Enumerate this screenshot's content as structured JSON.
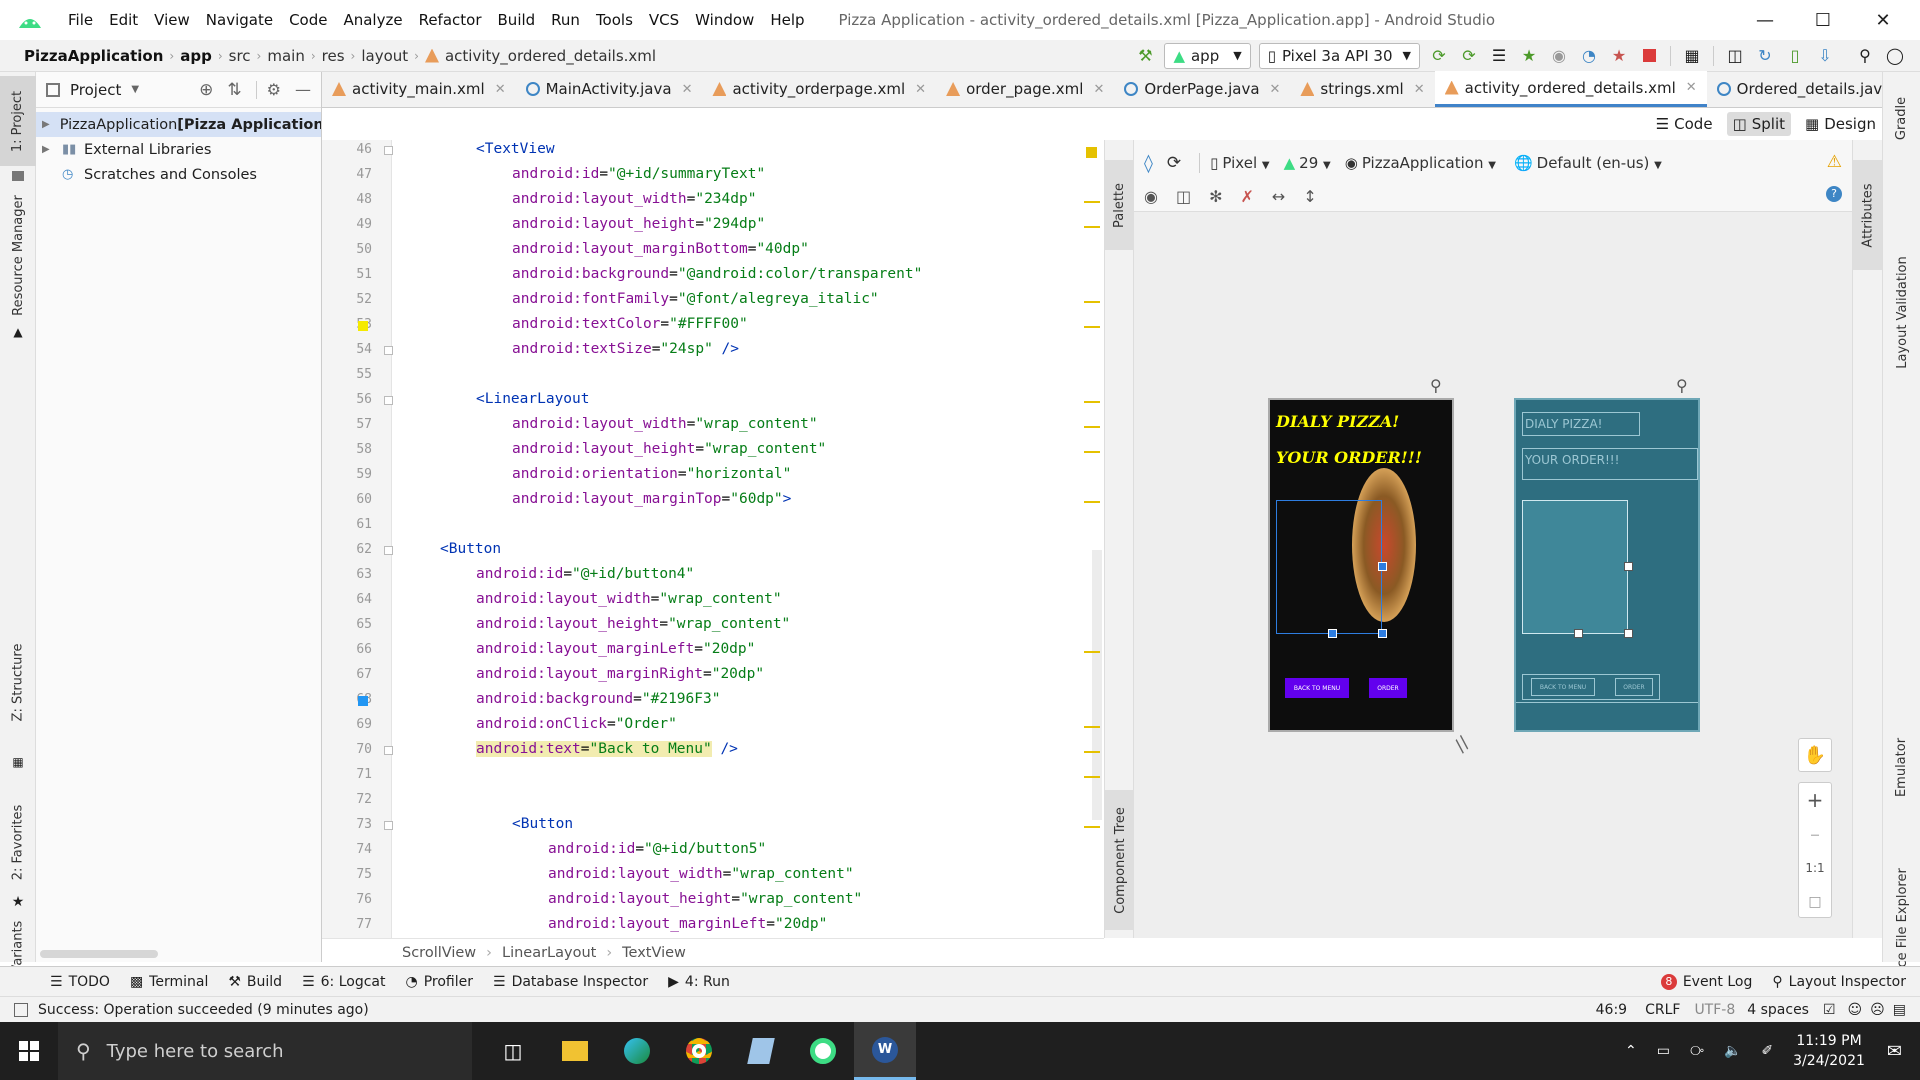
{
  "window": {
    "menu": [
      "File",
      "Edit",
      "View",
      "Navigate",
      "Code",
      "Analyze",
      "Refactor",
      "Build",
      "Run",
      "Tools",
      "VCS",
      "Window",
      "Help"
    ],
    "title": "Pizza Application - activity_ordered_details.xml [Pizza_Application.app] - Android Studio"
  },
  "nav": {
    "crumbs": [
      "PizzaApplication",
      "app",
      "src",
      "main",
      "res",
      "layout",
      "activity_ordered_details.xml"
    ],
    "run_config": "app",
    "device": "Pixel 3a API 30"
  },
  "left_stripe": {
    "project": "1: Project",
    "resource": "Resource Manager",
    "structure": "Z: Structure",
    "favorites": "2: Favorites",
    "build_variants": "Build Variants"
  },
  "project_panel": {
    "title": "Project",
    "items": [
      {
        "label_plain": "PizzaApplication ",
        "label_bold": "[Pizza Application]"
      },
      {
        "label": "External Libraries"
      },
      {
        "label": "Scratches and Consoles"
      }
    ]
  },
  "tabs": [
    {
      "label": "activity_main.xml",
      "type": "xml"
    },
    {
      "label": "MainActivity.java",
      "type": "java"
    },
    {
      "label": "activity_orderpage.xml",
      "type": "xml"
    },
    {
      "label": "order_page.xml",
      "type": "xml"
    },
    {
      "label": "OrderPage.java",
      "type": "java"
    },
    {
      "label": "strings.xml",
      "type": "xml"
    },
    {
      "label": "activity_ordered_details.xml",
      "type": "xml",
      "active": true
    },
    {
      "label": "Ordered_details.java",
      "type": "java"
    }
  ],
  "view_modes": {
    "code": "Code",
    "split": "Split",
    "design": "Design"
  },
  "editor": {
    "lines": [
      {
        "n": "46",
        "indent": 2,
        "parts": [
          [
            "tag",
            "<TextView"
          ]
        ]
      },
      {
        "n": "47",
        "indent": 3,
        "parts": [
          [
            "attr",
            "android:id"
          ],
          [
            "plain",
            "="
          ],
          [
            "val",
            "\"@+id/summaryText\""
          ]
        ]
      },
      {
        "n": "48",
        "indent": 3,
        "parts": [
          [
            "attr",
            "android:layout_width"
          ],
          [
            "plain",
            "="
          ],
          [
            "val",
            "\"234dp\""
          ]
        ]
      },
      {
        "n": "49",
        "indent": 3,
        "parts": [
          [
            "attr",
            "android:layout_height"
          ],
          [
            "plain",
            "="
          ],
          [
            "val",
            "\"294dp\""
          ]
        ]
      },
      {
        "n": "50",
        "indent": 3,
        "parts": [
          [
            "attr",
            "android:layout_marginBottom"
          ],
          [
            "plain",
            "="
          ],
          [
            "val",
            "\"40dp\""
          ]
        ]
      },
      {
        "n": "51",
        "indent": 3,
        "parts": [
          [
            "attr",
            "android:background"
          ],
          [
            "plain",
            "="
          ],
          [
            "val",
            "\"@android:color/transparent\""
          ]
        ]
      },
      {
        "n": "52",
        "indent": 3,
        "parts": [
          [
            "attr",
            "android:fontFamily"
          ],
          [
            "plain",
            "="
          ],
          [
            "val",
            "\"@font/alegreya_italic\""
          ]
        ]
      },
      {
        "n": "53",
        "indent": 3,
        "parts": [
          [
            "attr",
            "android:textColor"
          ],
          [
            "plain",
            "="
          ],
          [
            "val",
            "\"#FFFF00\""
          ]
        ]
      },
      {
        "n": "54",
        "indent": 3,
        "parts": [
          [
            "attr",
            "android:textSize"
          ],
          [
            "plain",
            "="
          ],
          [
            "val",
            "\"24sp\""
          ],
          [
            "plain",
            " "
          ],
          [
            "tag",
            "/>"
          ]
        ]
      },
      {
        "n": "55",
        "indent": 0,
        "parts": []
      },
      {
        "n": "56",
        "indent": 2,
        "parts": [
          [
            "tag",
            "<LinearLayout"
          ]
        ]
      },
      {
        "n": "57",
        "indent": 3,
        "parts": [
          [
            "attr",
            "android:layout_width"
          ],
          [
            "plain",
            "="
          ],
          [
            "val",
            "\"wrap_content\""
          ]
        ]
      },
      {
        "n": "58",
        "indent": 3,
        "parts": [
          [
            "attr",
            "android:layout_height"
          ],
          [
            "plain",
            "="
          ],
          [
            "val",
            "\"wrap_content\""
          ]
        ]
      },
      {
        "n": "59",
        "indent": 3,
        "parts": [
          [
            "attr",
            "android:orientation"
          ],
          [
            "plain",
            "="
          ],
          [
            "val",
            "\"horizontal\""
          ]
        ]
      },
      {
        "n": "60",
        "indent": 3,
        "parts": [
          [
            "attr",
            "android:layout_marginTop"
          ],
          [
            "plain",
            "="
          ],
          [
            "val",
            "\"60dp\""
          ],
          [
            "tag",
            ">"
          ]
        ]
      },
      {
        "n": "61",
        "indent": 0,
        "parts": []
      },
      {
        "n": "62",
        "indent": 1,
        "parts": [
          [
            "tag",
            "<Button"
          ]
        ]
      },
      {
        "n": "63",
        "indent": 2,
        "parts": [
          [
            "attr",
            "android:id"
          ],
          [
            "plain",
            "="
          ],
          [
            "val",
            "\"@+id/button4\""
          ]
        ]
      },
      {
        "n": "64",
        "indent": 2,
        "parts": [
          [
            "attr",
            "android:layout_width"
          ],
          [
            "plain",
            "="
          ],
          [
            "val",
            "\"wrap_content\""
          ]
        ]
      },
      {
        "n": "65",
        "indent": 2,
        "parts": [
          [
            "attr",
            "android:layout_height"
          ],
          [
            "plain",
            "="
          ],
          [
            "val",
            "\"wrap_content\""
          ]
        ]
      },
      {
        "n": "66",
        "indent": 2,
        "parts": [
          [
            "attr",
            "android:layout_marginLeft"
          ],
          [
            "plain",
            "="
          ],
          [
            "val",
            "\"20dp\""
          ]
        ]
      },
      {
        "n": "67",
        "indent": 2,
        "parts": [
          [
            "attr",
            "android:layout_marginRight"
          ],
          [
            "plain",
            "="
          ],
          [
            "val",
            "\"20dp\""
          ]
        ]
      },
      {
        "n": "68",
        "indent": 2,
        "parts": [
          [
            "attr",
            "android:background"
          ],
          [
            "plain",
            "="
          ],
          [
            "val",
            "\"#2196F3\""
          ]
        ]
      },
      {
        "n": "69",
        "indent": 2,
        "parts": [
          [
            "attr",
            "android:onClick"
          ],
          [
            "plain",
            "="
          ],
          [
            "val",
            "\"Order\""
          ]
        ]
      },
      {
        "n": "70",
        "indent": 2,
        "parts": [
          [
            "hattr",
            "android:text"
          ],
          [
            "hplain",
            "="
          ],
          [
            "hval",
            "\"Back to Menu\""
          ],
          [
            "plain",
            " "
          ],
          [
            "tag",
            "/>"
          ]
        ]
      },
      {
        "n": "71",
        "indent": 0,
        "parts": []
      },
      {
        "n": "72",
        "indent": 0,
        "parts": []
      },
      {
        "n": "73",
        "indent": 3,
        "parts": [
          [
            "tag",
            "<Button"
          ]
        ]
      },
      {
        "n": "74",
        "indent": 4,
        "parts": [
          [
            "attr",
            "android:id"
          ],
          [
            "plain",
            "="
          ],
          [
            "val",
            "\"@+id/button5\""
          ]
        ]
      },
      {
        "n": "75",
        "indent": 4,
        "parts": [
          [
            "attr",
            "android:layout_width"
          ],
          [
            "plain",
            "="
          ],
          [
            "val",
            "\"wrap_content\""
          ]
        ]
      },
      {
        "n": "76",
        "indent": 4,
        "parts": [
          [
            "attr",
            "android:layout_height"
          ],
          [
            "plain",
            "="
          ],
          [
            "val",
            "\"wrap_content\""
          ]
        ]
      },
      {
        "n": "77",
        "indent": 4,
        "parts": [
          [
            "attr",
            "android:layout_marginLeft"
          ],
          [
            "plain",
            "="
          ],
          [
            "val",
            "\"20dp\""
          ]
        ]
      }
    ]
  },
  "code_breadcrumb": [
    "ScrollView",
    "LinearLayout",
    "TextView"
  ],
  "palette": {
    "palette": "Palette",
    "component_tree": "Component Tree"
  },
  "design_toolbar": {
    "device": "Pixel",
    "api": "29",
    "theme": "PizzaApplication",
    "locale": "Default (en-us)"
  },
  "preview": {
    "title": "DIALY PIZZA!",
    "subtitle": "YOUR ORDER!!!",
    "btn_back": "BACK TO MENU",
    "btn_order": "ORDER",
    "blueprint_title": "DIALY PIZZA!",
    "blueprint_subtitle": "YOUR ORDER!!!",
    "blueprint_back": "BACK TO MENU",
    "blueprint_order": "ORDER"
  },
  "zoom": {
    "one_to_one": "1:1"
  },
  "right_stripe": {
    "gradle": "Gradle",
    "attributes": "Attributes",
    "layout_validation": "Layout Validation",
    "emulator": "Emulator",
    "device_file_explorer": "Device File Explorer"
  },
  "bottom_tools": [
    {
      "label": "TODO"
    },
    {
      "label": "Terminal"
    },
    {
      "label": "Build"
    },
    {
      "label": "6: Logcat"
    },
    {
      "label": "Profiler"
    },
    {
      "label": "Database Inspector"
    },
    {
      "label": "4: Run"
    }
  ],
  "bottom_right_tools": {
    "event_log": "Event Log",
    "event_count": "8",
    "layout_inspector": "Layout Inspector"
  },
  "status": {
    "message": "Success: Operation succeeded (9 minutes ago)",
    "position": "46:9",
    "line_sep": "CRLF",
    "encoding": "UTF-8",
    "indent": "4 spaces"
  },
  "taskbar": {
    "search_placeholder": "Type here to search",
    "time": "11:19 PM",
    "date": "3/24/2021"
  },
  "colors": {
    "accent": "#4083c9",
    "preview_bg": "#0d0d0d",
    "preview_title": "#ffff00",
    "preview_button": "#6200ee",
    "blueprint_bg": "#2e6e80"
  }
}
